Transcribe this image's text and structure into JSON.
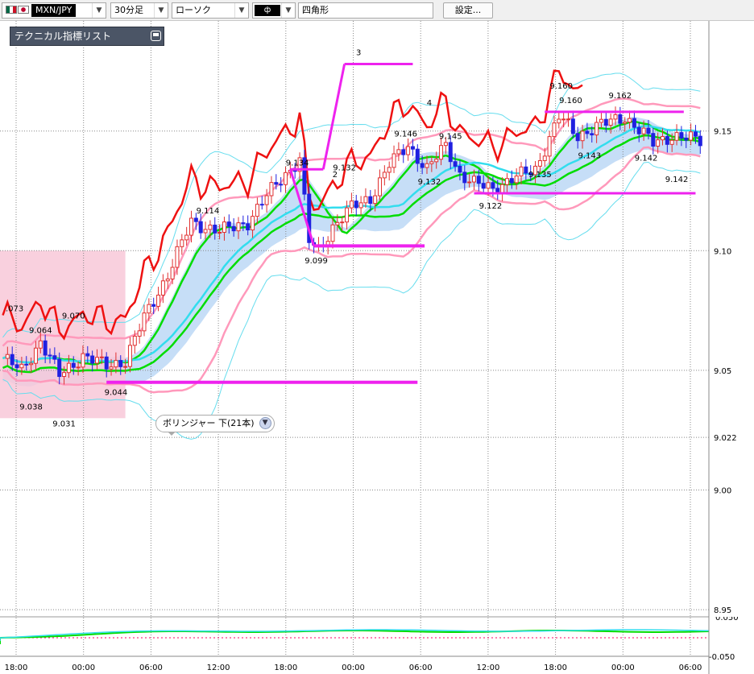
{
  "toolbar": {
    "symbol": "MXN/JPY",
    "timeframe": "30分足",
    "chart_type": "ローソク",
    "color_button": "ф",
    "drawing_tool": "四角形",
    "settings_label": "設定..."
  },
  "indicator_list": {
    "title": "テクニカル指標リスト"
  },
  "tooltip": {
    "text": "ボリンジャー 下(21本)"
  },
  "colors": {
    "up_candle": "#e03030",
    "down_candle": "#2020e0",
    "bb_outer": "#66ddee",
    "bb_inner": "#ff99bb",
    "ma_green": "#00dd00",
    "ma_cyan": "#33ddee",
    "trail_red": "#ee1111",
    "drawing_magenta": "#ee22ee",
    "cloud_blue": "#bcd8f6",
    "cloud_pink": "#f8c8d8"
  },
  "chart_data": {
    "type": "candlestick",
    "y_ticks": [
      "9.15",
      "9.10",
      "9.05",
      "9.022",
      "9.00",
      "8.95"
    ],
    "x_ticks": [
      "18:00",
      "00:00",
      "06:00",
      "12:00",
      "18:00",
      "00:00",
      "06:00",
      "12:00",
      "18:00",
      "00:00",
      "06:00"
    ],
    "ylim": [
      8.947,
      9.196
    ],
    "annotations": [
      {
        "label": ".073",
        "x": 2.5,
        "y": 9.076
      },
      {
        "label": "9.064",
        "x": 8,
        "y": 9.067
      },
      {
        "label": "9.070",
        "x": 15,
        "y": 9.073
      },
      {
        "label": "9.038",
        "x": 6,
        "y": 9.035
      },
      {
        "label": "9.031",
        "x": 13,
        "y": 9.028
      },
      {
        "label": "9.044",
        "x": 24,
        "y": 9.041
      },
      {
        "label": "9.114",
        "x": 43.5,
        "y": 9.117
      },
      {
        "label": "9.134",
        "x": 62.5,
        "y": 9.137
      },
      {
        "label": "9.132",
        "x": 72.5,
        "y": 9.135
      },
      {
        "label": "9.099",
        "x": 66.5,
        "y": 9.096
      },
      {
        "label": "9.146",
        "x": 85.5,
        "y": 9.149
      },
      {
        "label": "9.132",
        "x": 90.5,
        "y": 9.129
      },
      {
        "label": "9.145",
        "x": 95,
        "y": 9.148
      },
      {
        "label": "9.122",
        "x": 103.5,
        "y": 9.119
      },
      {
        "label": "9.135",
        "x": 114,
        "y": 9.132
      },
      {
        "label": "9.160",
        "x": 120.5,
        "y": 9.163
      },
      {
        "label": "9.160",
        "x": 118.5,
        "y": 9.169
      },
      {
        "label": "9.143",
        "x": 124.5,
        "y": 9.14
      },
      {
        "label": "9.162",
        "x": 131,
        "y": 9.165
      },
      {
        "label": "9.142",
        "x": 136.5,
        "y": 9.139
      },
      {
        "label": "9.142",
        "x": 143,
        "y": 9.13
      }
    ],
    "drawing_labels": [
      {
        "label": "3",
        "x": 75.5,
        "y": 9.183
      },
      {
        "label": "4",
        "x": 90.5,
        "y": 9.162
      },
      {
        "label": "2",
        "x": 70.5,
        "y": 9.132
      }
    ],
    "oscillator": {
      "upper": "0.050",
      "lower": "-0.050"
    }
  }
}
